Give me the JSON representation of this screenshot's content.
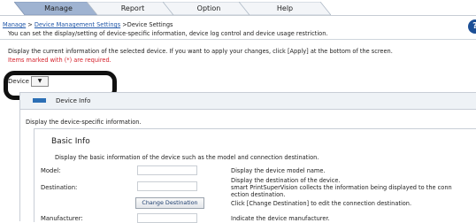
{
  "tabs": [
    {
      "label": "Manage",
      "active": true
    },
    {
      "label": "Report",
      "active": false
    },
    {
      "label": "Option",
      "active": false
    },
    {
      "label": "Help",
      "active": false
    }
  ],
  "colors": {
    "active_tab": "#9fb3d1",
    "inactive_tab": "#f3f5f8",
    "required_text": "#d4202a",
    "link": "#1f56a8",
    "accent": "#2c6fb5"
  },
  "breadcrumb": {
    "manage": "Manage",
    "sep": " > ",
    "device_management": "Device Management Settings",
    "sep2": " >",
    "current": "Device Settings"
  },
  "help_icon": "?",
  "page_description": "You can set the display/setting of device-specific information, device log control and device usage restriction.",
  "instruction": "Display the current information of the selected device. If you want to apply your changes, click [Apply] at the bottom of the screen.",
  "required_note": "Items marked with (*) are required.",
  "device_selector": {
    "label": "Device",
    "arrow": "▼"
  },
  "device_info": {
    "header": "Device Info",
    "description": "Display the device-specific information."
  },
  "basic_info": {
    "title": "Basic Info",
    "description": "Display the basic information of the device such as the model and connection destination.",
    "rows": {
      "model_label": "Model:",
      "model_info": "Display the device model name.",
      "destination_label": "Destination:",
      "destination_info_1": "Display the destination of the device.",
      "destination_info_2": "smart PrintSuperVision collects the information being displayed to the conn",
      "destination_info_3": "ection destination.",
      "change_button": "Change Destination",
      "change_info": "Click [Change Destination] to edit the connection destination.",
      "manufacturer_label": "Manufacturer:",
      "manufacturer_info": "Indicate the device manufacturer."
    }
  }
}
